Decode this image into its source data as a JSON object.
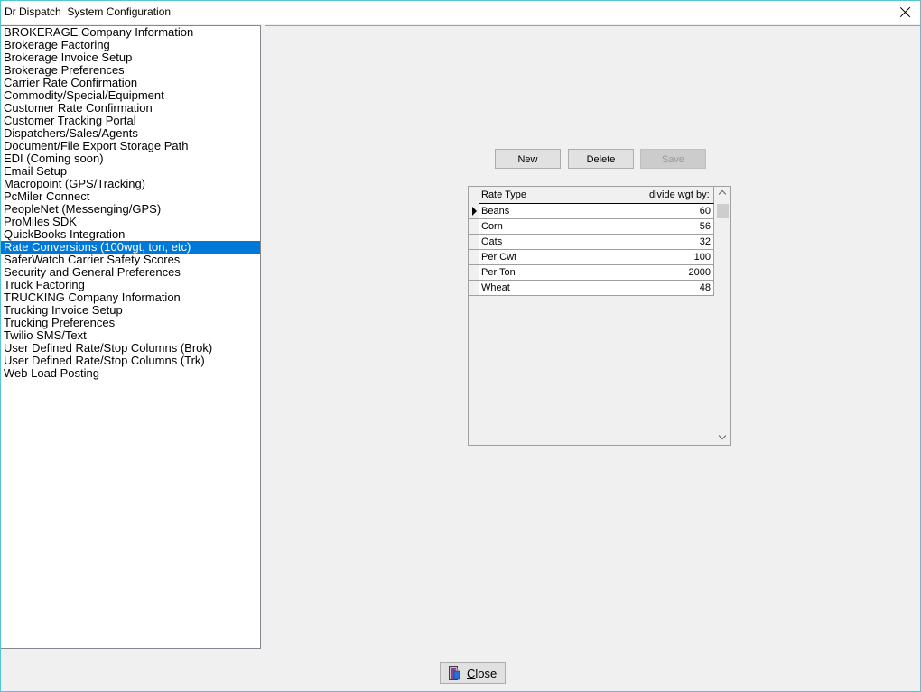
{
  "window": {
    "title": "Dr Dispatch  System Configuration"
  },
  "sidebar": {
    "items": [
      {
        "label": "BROKERAGE Company Information"
      },
      {
        "label": "Brokerage Factoring"
      },
      {
        "label": "Brokerage Invoice Setup"
      },
      {
        "label": "Brokerage Preferences"
      },
      {
        "label": "Carrier Rate Confirmation"
      },
      {
        "label": "Commodity/Special/Equipment"
      },
      {
        "label": "Customer Rate Confirmation"
      },
      {
        "label": "Customer Tracking Portal"
      },
      {
        "label": "Dispatchers/Sales/Agents"
      },
      {
        "label": "Document/File Export Storage Path"
      },
      {
        "label": "EDI (Coming soon)"
      },
      {
        "label": "Email Setup"
      },
      {
        "label": "Macropoint (GPS/Tracking)"
      },
      {
        "label": "PcMiler Connect"
      },
      {
        "label": "PeopleNet (Messenging/GPS)"
      },
      {
        "label": "ProMiles SDK"
      },
      {
        "label": "QuickBooks Integration"
      },
      {
        "label": "Rate Conversions (100wgt, ton, etc)"
      },
      {
        "label": "SaferWatch Carrier Safety Scores"
      },
      {
        "label": "Security and General Preferences"
      },
      {
        "label": "Truck Factoring"
      },
      {
        "label": "TRUCKING Company Information"
      },
      {
        "label": "Trucking Invoice Setup"
      },
      {
        "label": "Trucking Preferences"
      },
      {
        "label": "Twilio SMS/Text"
      },
      {
        "label": "User Defined Rate/Stop Columns (Brok)"
      },
      {
        "label": "User Defined Rate/Stop Columns (Trk)"
      },
      {
        "label": "Web Load Posting"
      }
    ],
    "selected_index": 17
  },
  "toolbar": {
    "new_label": "New",
    "delete_label": "Delete",
    "save_label": "Save"
  },
  "grid": {
    "columns": [
      "Rate Type",
      "divide wgt by:"
    ],
    "rows": [
      {
        "rate_type": "Beans",
        "divisor": "60"
      },
      {
        "rate_type": "Corn",
        "divisor": "56"
      },
      {
        "rate_type": "Oats",
        "divisor": "32"
      },
      {
        "rate_type": "Per Cwt",
        "divisor": "100"
      },
      {
        "rate_type": "Per Ton",
        "divisor": "2000"
      },
      {
        "rate_type": "Wheat",
        "divisor": "48"
      }
    ],
    "current_row": 0
  },
  "footer": {
    "close_label": "Close",
    "close_icon": "exit-door-icon"
  },
  "colors": {
    "selection": "#0078d7",
    "window_border": "#52c6d1",
    "background": "#f0f0f0"
  }
}
